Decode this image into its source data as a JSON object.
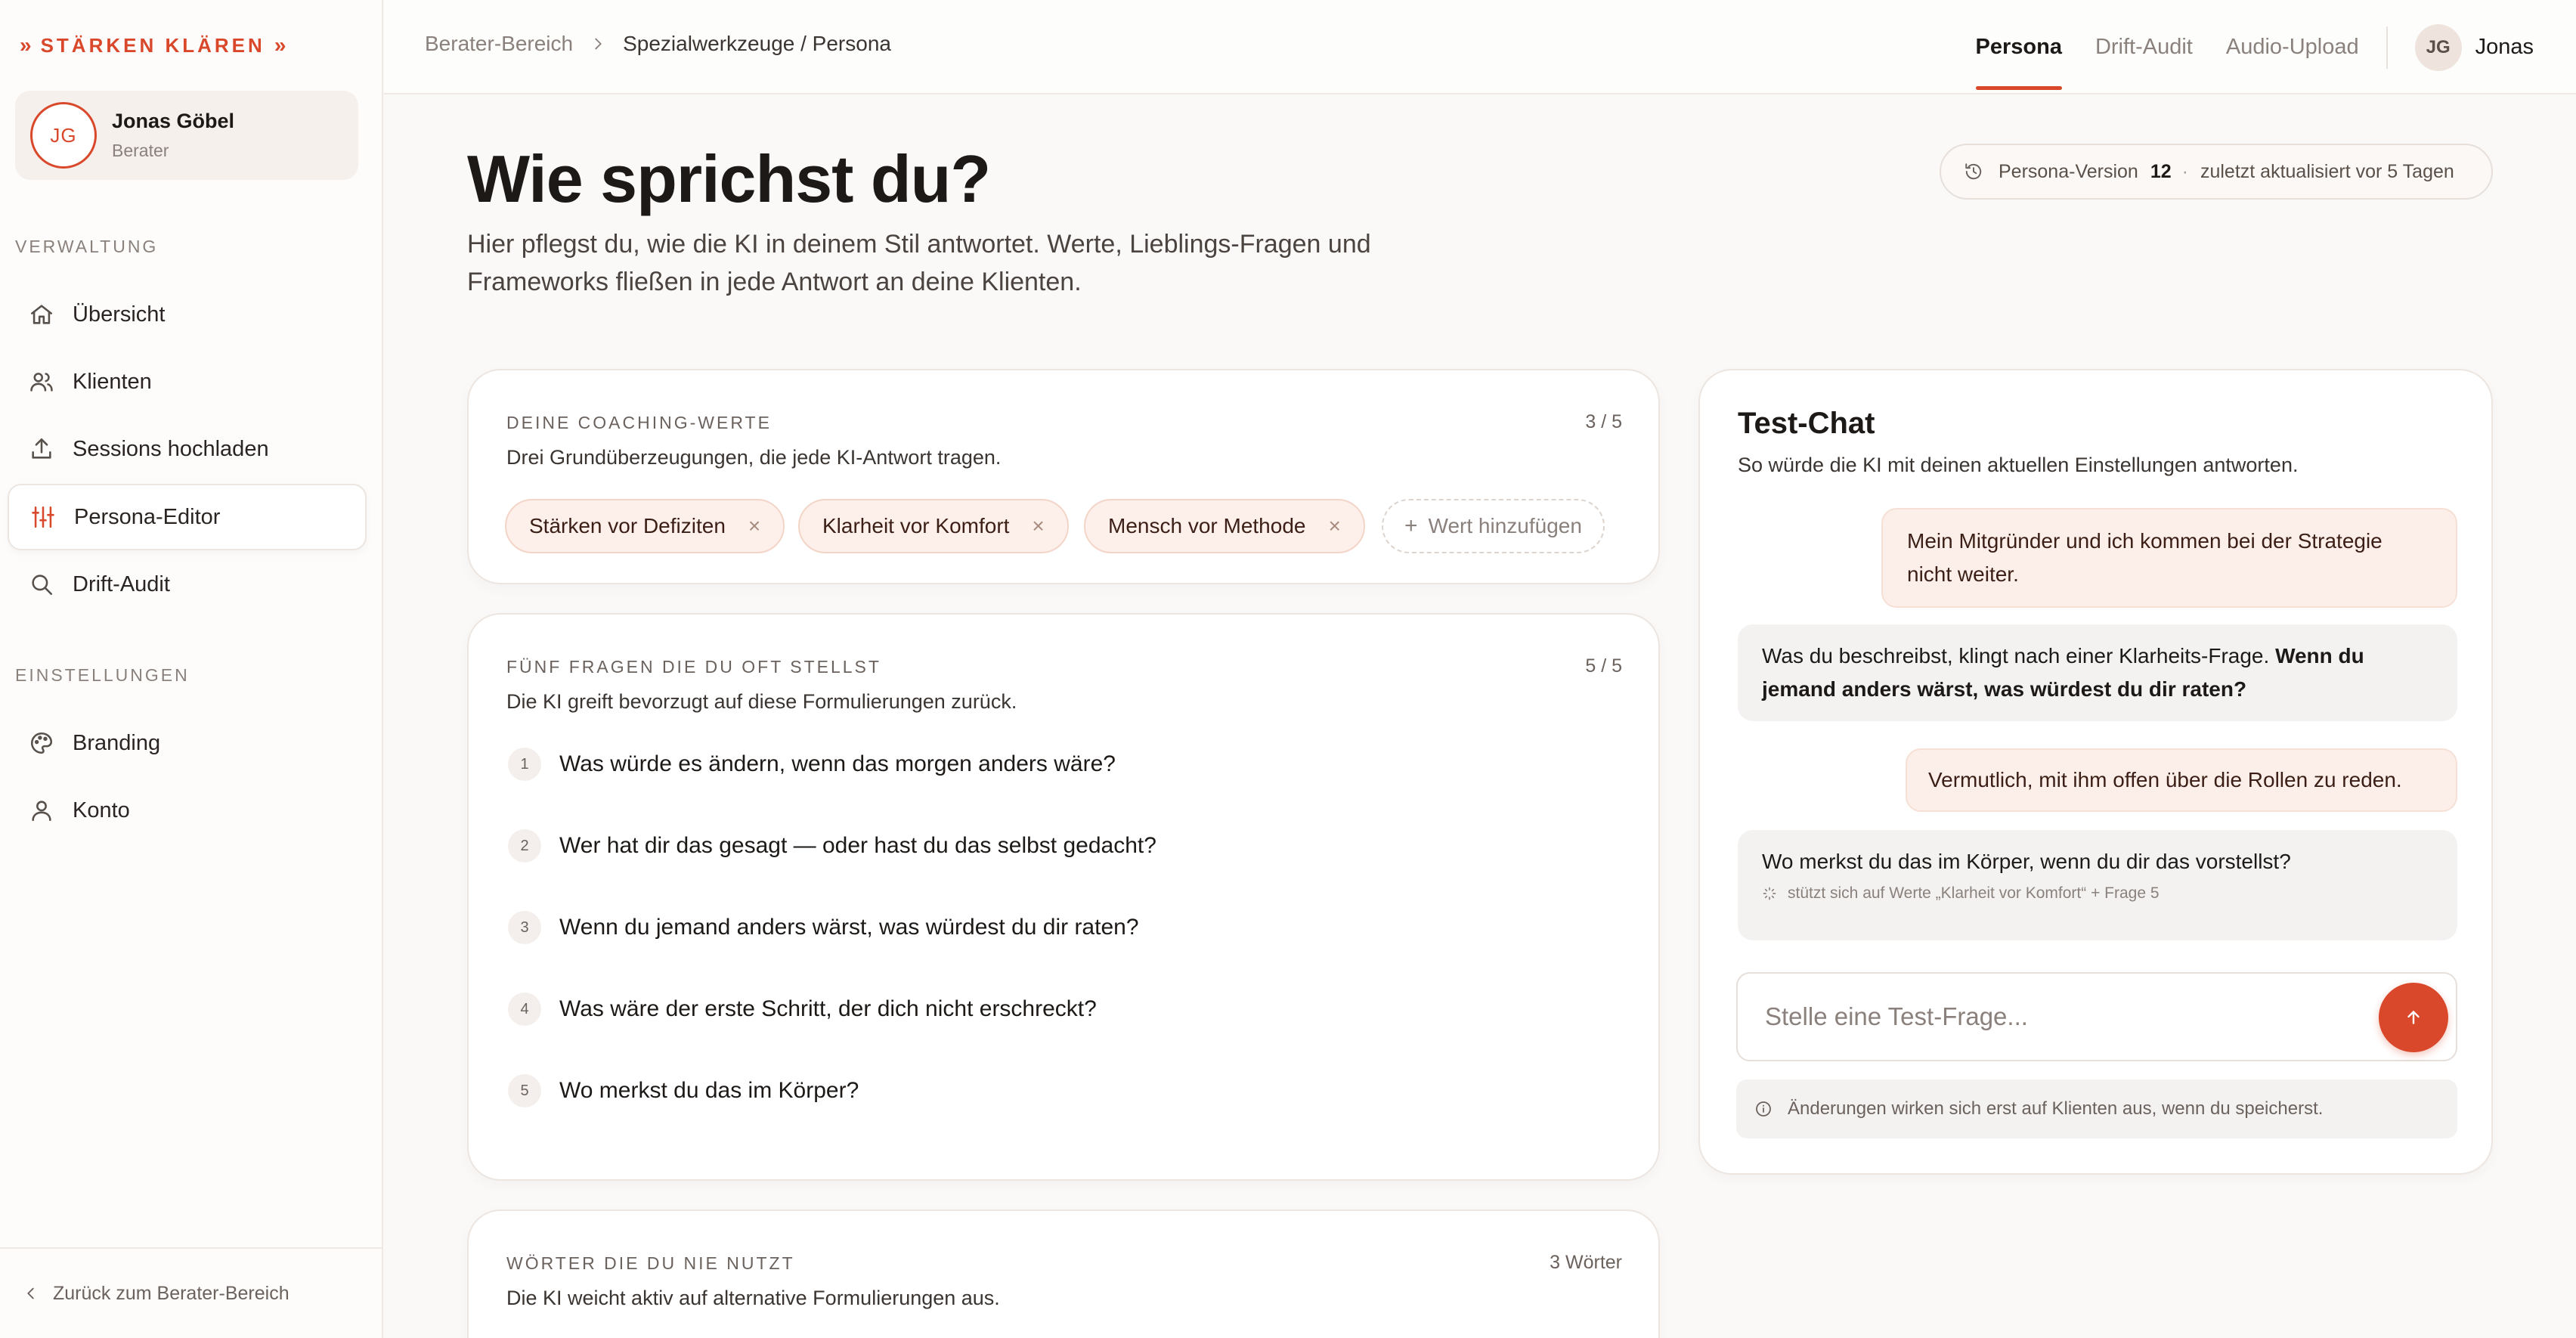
{
  "brand": {
    "prefix": "»",
    "name": "STÄRKEN KLÄREN",
    "suffix": "»"
  },
  "profile": {
    "initials": "JG",
    "name": "Jonas Göbel",
    "role": "Berater"
  },
  "sidebar": {
    "section_admin": "VERWALTUNG",
    "items": [
      {
        "label": "Übersicht",
        "icon": "home-icon"
      },
      {
        "label": "Klienten",
        "icon": "users-icon"
      },
      {
        "label": "Sessions hochladen",
        "icon": "upload-icon"
      },
      {
        "label": "Persona-Editor",
        "icon": "sliders-icon",
        "active": true
      },
      {
        "label": "Drift-Audit",
        "icon": "search-icon"
      }
    ],
    "section_settings": "EINSTELLUNGEN",
    "settings_items": [
      {
        "label": "Branding",
        "icon": "palette-icon"
      },
      {
        "label": "Konto",
        "icon": "user-icon"
      }
    ],
    "back_label": "Zurück zum Berater-Bereich"
  },
  "header": {
    "breadcrumb": [
      "Berater-Bereich",
      "Spezialwerkzeuge / Persona"
    ],
    "tabs": [
      "Persona",
      "Drift-Audit",
      "Audio-Upload"
    ],
    "active_tab": "Persona",
    "user_initials": "JG",
    "user_name": "Jonas"
  },
  "page": {
    "title": "Wie sprichst du?",
    "subtitle": "Hier pflegst du, wie die KI in deinem Stil antwortet. Werte, Lieblings-Fragen und Frameworks fließen in jede Antwort an deine Klienten.",
    "version_label": "Persona-Version",
    "version_number": "12",
    "version_separator": "·",
    "version_updated": "zuletzt aktualisiert vor 5 Tagen"
  },
  "values_card": {
    "label": "DEINE COACHING-WERTE",
    "count": "3 / 5",
    "description": "Drei Grundüberzeugungen, die jede KI-Antwort tragen.",
    "values": [
      "Stärken vor Defiziten",
      "Klarheit vor Komfort",
      "Mensch vor Methode"
    ],
    "remove_symbol": "×",
    "add_label": "Wert hinzufügen",
    "add_symbol": "+"
  },
  "questions_card": {
    "label": "FÜNF FRAGEN DIE DU OFT STELLST",
    "count": "5 / 5",
    "description": "Die KI greift bevorzugt auf diese Formulierungen zurück.",
    "questions": [
      {
        "num": "1",
        "text": "Was würde es ändern, wenn das morgen anders wäre?"
      },
      {
        "num": "2",
        "text": "Wer hat dir das gesagt — oder hast du das selbst gedacht?"
      },
      {
        "num": "3",
        "text": "Wenn du jemand anders wärst, was würdest du dir raten?"
      },
      {
        "num": "4",
        "text": "Was wäre der erste Schritt, der dich nicht erschreckt?"
      },
      {
        "num": "5",
        "text": "Wo merkst du das im Körper?"
      }
    ]
  },
  "words_card": {
    "label": "WÖRTER DIE DU NIE NUTZT",
    "count": "3 Wörter",
    "description": "Die KI weicht aktiv auf alternative Formulierungen aus."
  },
  "test_chat": {
    "title": "Test-Chat",
    "subtitle": "So würde die KI mit deinen aktuellen Einstellungen antworten.",
    "messages": [
      {
        "role": "user",
        "text": "Mein Mitgründer und ich kommen bei der Strategie nicht weiter."
      },
      {
        "role": "ai",
        "text": "Was du beschreibst, klingt nach einer Klarheits-Frage.",
        "bold": "Wenn du jemand anders wärst, was würdest du dir raten?"
      },
      {
        "role": "user",
        "text": "Vermutlich, mit ihm offen über die Rollen zu reden."
      },
      {
        "role": "ai",
        "text": "Wo merkst du das im Körper, wenn du dir das vorstellst?",
        "source": "stützt sich auf Werte „Klarheit vor Komfort“ + Frage 5"
      }
    ],
    "input_placeholder": "Stelle eine Test-Frage...",
    "notice": "Änderungen wirken sich erst auf Klienten aus, wenn du speicherst."
  },
  "colors": {
    "accent": "#d9482b",
    "chip_bg": "#fdf0ea",
    "background": "#fbf9f8"
  }
}
